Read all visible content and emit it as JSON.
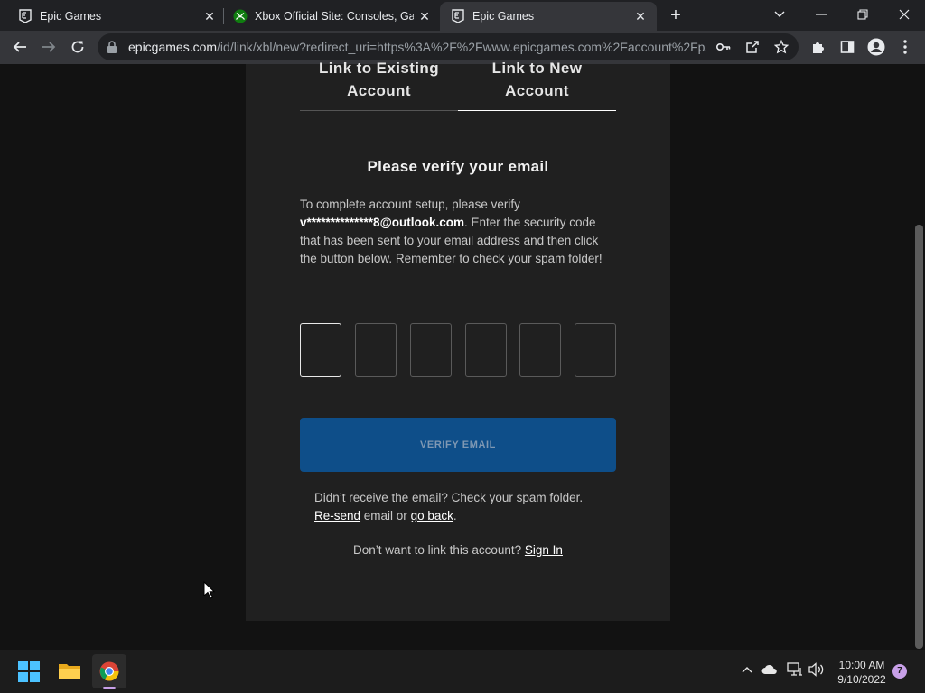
{
  "browser": {
    "tabs": [
      {
        "title": "Epic Games",
        "favicon": "epic-games-icon",
        "active": false
      },
      {
        "title": "Xbox Official Site: Consoles, Gam",
        "favicon": "xbox-icon",
        "active": false
      },
      {
        "title": "Epic Games",
        "favicon": "epic-games-icon",
        "active": true
      }
    ],
    "url_host": "epicgames.com",
    "url_path": "/id/link/xbl/new?redirect_uri=https%3A%2F%2Fwww.epicgames.com%2Faccount%2Fp..."
  },
  "page": {
    "tab_existing": "Link to Existing Account",
    "tab_new": "Link to New Account",
    "heading": "Please verify your email",
    "desc_before": "To complete account setup, please verify ",
    "desc_email": "v**************8@outlook.com",
    "desc_after": ". Enter the security code that has been sent to your email address and then click the button below. Remember to check your spam folder!",
    "code_count": 6,
    "verify_label": "VERIFY EMAIL",
    "resend_before": "Didn’t receive the email? Check your spam folder.",
    "resend_link": "Re-send",
    "resend_mid": " email or ",
    "goback_link": "go back",
    "resend_end": ".",
    "signin_before": "Don’t want to link this account? ",
    "signin_link": "Sign In"
  },
  "taskbar": {
    "time": "10:00 AM",
    "date": "9/10/2022",
    "notifications": "7"
  }
}
